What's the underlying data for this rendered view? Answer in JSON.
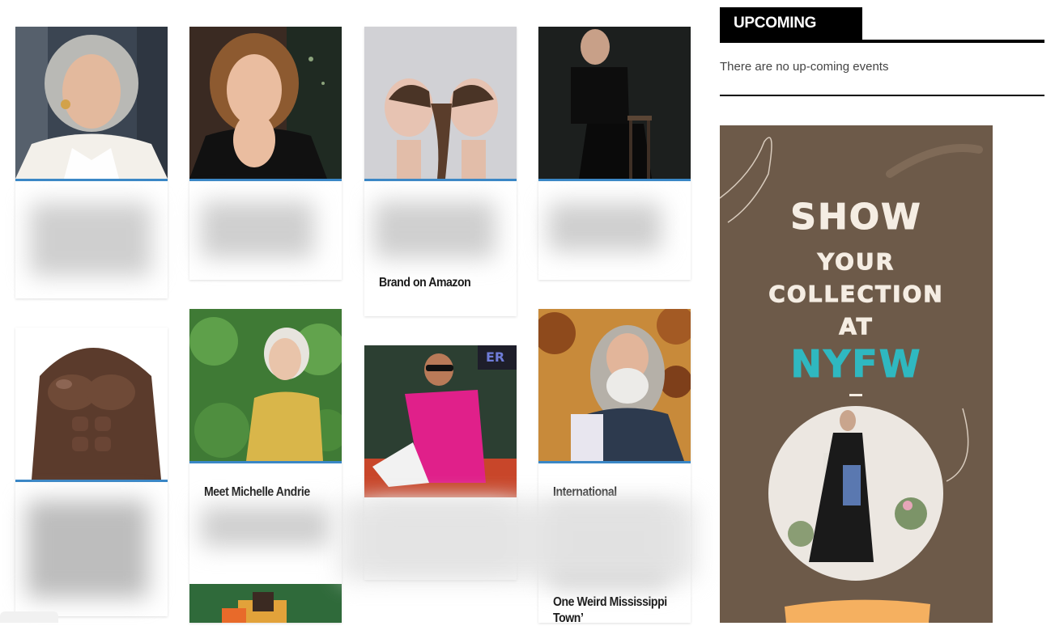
{
  "sidebar": {
    "events_title": "UPCOMING EVENTS",
    "events_empty_text": "There are no up-coming events",
    "ad": {
      "line1": "SHOW",
      "line2": "YOUR",
      "line3": "COLLECTION",
      "line4": "AT",
      "line5": "NYFW",
      "accent_color": "#2fb8c0",
      "background_color": "#6d5a49"
    }
  },
  "cards": [
    {
      "name": "card-woman-gray-hair",
      "title": ""
    },
    {
      "name": "card-woman-black-top",
      "title": ""
    },
    {
      "name": "card-twin-ponytails",
      "title": "Brand on Amazon"
    },
    {
      "name": "card-woman-seated",
      "title": ""
    },
    {
      "name": "card-muscular-torso",
      "title": ""
    },
    {
      "name": "card-michelle-andrie",
      "title": "Meet Michelle Andrie"
    },
    {
      "name": "card-man-pink-suit",
      "title": ""
    },
    {
      "name": "card-international",
      "title": "International",
      "title_bottom_1": "One Weird Mississippi",
      "title_bottom_2": "Town’"
    }
  ],
  "colors": {
    "card_accent_border": "#3a87c6",
    "events_header_bg": "#000000"
  }
}
